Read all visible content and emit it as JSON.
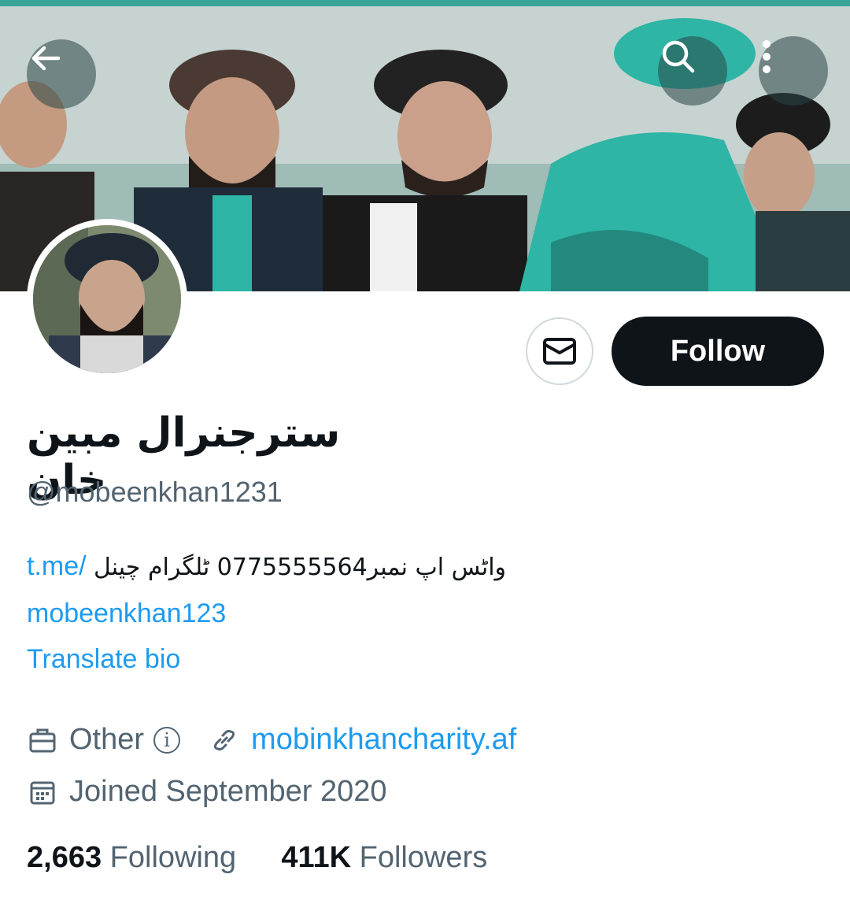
{
  "header": {
    "back_icon": "arrow-left-icon",
    "search_icon": "search-icon",
    "more_icon": "more-vertical-icon"
  },
  "profile": {
    "display_name": "سترجنرال مبین خان",
    "handle": "@mobeenkhan1231",
    "follow_label": "Follow",
    "message_icon": "envelope-icon",
    "bio": {
      "urdu_text": "واٹس اپ نمبر0775555564  ٹلگرام چینل",
      "link_part1": "t.me/",
      "link_part2": "mobeenkhan123"
    },
    "translate_label": "Translate bio",
    "category": "Other",
    "website": "mobinkhancharity.af",
    "joined": "Joined September 2020",
    "following_count": "2,663",
    "following_label": "Following",
    "followers_count": "411K",
    "followers_label": "Followers"
  },
  "colors": {
    "accent": "#1d9bf0",
    "banner_teal": "#2fb5a6",
    "button_dark": "#0f1419",
    "muted": "#536471"
  }
}
